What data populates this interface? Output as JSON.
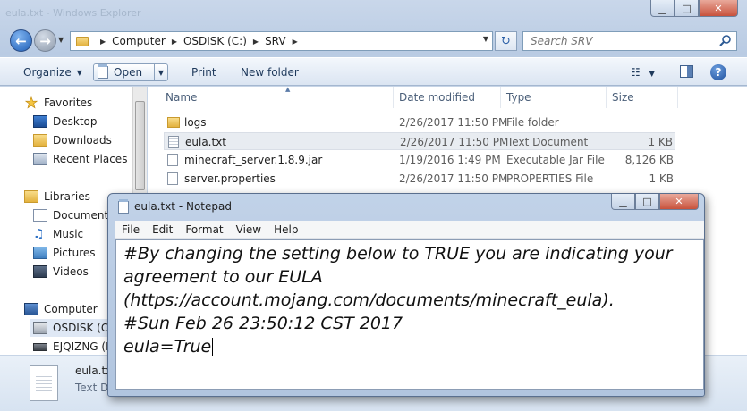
{
  "explorer": {
    "title_ghost": "eula.txt - Windows Explorer",
    "address": {
      "segments": [
        "Computer",
        "OSDISK (C:)",
        "SRV"
      ]
    },
    "search": {
      "placeholder": "Search SRV"
    },
    "toolbar": {
      "organize": "Organize",
      "open": "Open",
      "print": "Print",
      "new_folder": "New folder"
    },
    "nav": {
      "favorites": {
        "label": "Favorites",
        "items": [
          "Desktop",
          "Downloads",
          "Recent Places"
        ]
      },
      "libraries": {
        "label": "Libraries",
        "items": [
          "Documents",
          "Music",
          "Pictures",
          "Videos"
        ]
      },
      "computer": {
        "label": "Computer",
        "items": [
          "OSDISK (C:)",
          "EJQIZNG (F:"
        ]
      }
    },
    "columns": {
      "name": "Name",
      "date": "Date modified",
      "type": "Type",
      "size": "Size"
    },
    "files": [
      {
        "name": "logs",
        "date": "2/26/2017 11:50 PM",
        "type": "File folder",
        "size": "",
        "icon": "folder-icon"
      },
      {
        "name": "eula.txt",
        "date": "2/26/2017 11:50 PM",
        "type": "Text Document",
        "size": "1 KB",
        "icon": "text-file-icon"
      },
      {
        "name": "minecraft_server.1.8.9.jar",
        "date": "1/19/2016 1:49 PM",
        "type": "Executable Jar File",
        "size": "8,126 KB",
        "icon": "jar-file-icon"
      },
      {
        "name": "server.properties",
        "date": "2/26/2017 11:50 PM",
        "type": "PROPERTIES File",
        "size": "1 KB",
        "icon": "file-icon"
      }
    ],
    "details": {
      "name": "eula.txt",
      "type": "Text D"
    }
  },
  "notepad": {
    "title": "eula.txt - Notepad",
    "menu": [
      "File",
      "Edit",
      "Format",
      "View",
      "Help"
    ],
    "lines": [
      "#By changing the setting below to TRUE you are indicating your",
      "agreement to our EULA",
      "(https://account.mojang.com/documents/minecraft_eula).",
      "#Sun Feb 26 23:50:12 CST 2017",
      "eula=True"
    ]
  },
  "colors": {
    "accent": "#1f5fb8",
    "selection": "#e8ecf1",
    "close": "#c8523c"
  }
}
